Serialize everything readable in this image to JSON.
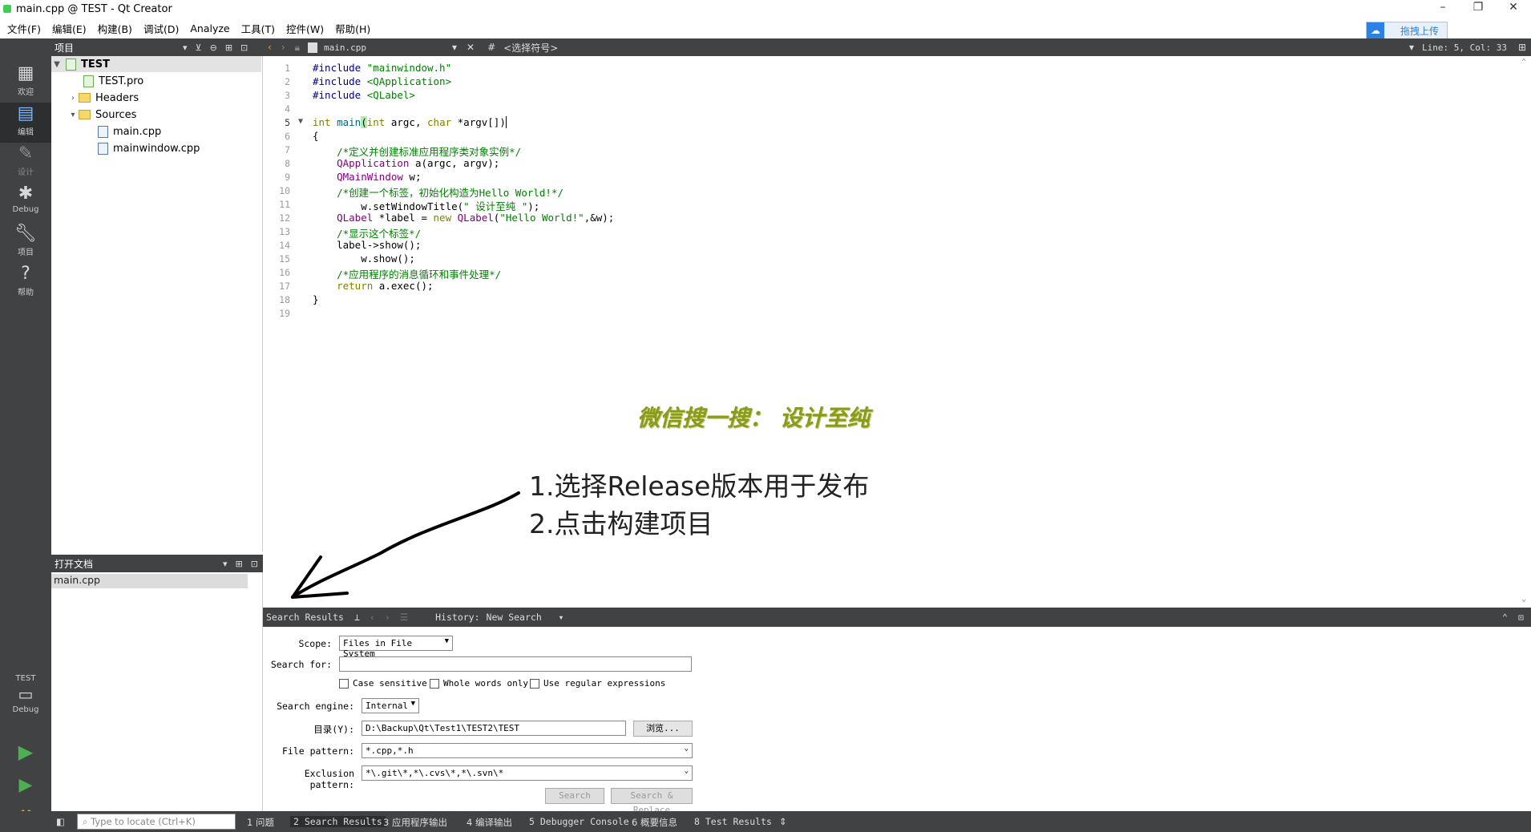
{
  "window": {
    "title": "main.cpp @ TEST - Qt Creator",
    "cloud_label": "拖拽上传"
  },
  "menu": [
    "文件(F)",
    "编辑(E)",
    "构建(B)",
    "调试(D)",
    "Analyze",
    "工具(T)",
    "控件(W)",
    "帮助(H)"
  ],
  "modes": [
    {
      "label": "欢迎",
      "icon": "grid-icon"
    },
    {
      "label": "编辑",
      "icon": "edit-doc-icon"
    },
    {
      "label": "设计",
      "icon": "pencil-icon"
    },
    {
      "label": "Debug",
      "icon": "bug-icon"
    },
    {
      "label": "项目",
      "icon": "wrench-icon"
    },
    {
      "label": "帮助",
      "icon": "help-icon"
    }
  ],
  "kit": {
    "project": "TEST",
    "config": "Debug"
  },
  "project_pane": {
    "title": "项目"
  },
  "tree": {
    "root": "TEST",
    "pro": "TEST.pro",
    "headers": "Headers",
    "sources": "Sources",
    "files": [
      "main.cpp",
      "mainwindow.cpp"
    ]
  },
  "open_docs": {
    "title": "打开文档",
    "items": [
      "main.cpp"
    ]
  },
  "editor": {
    "file": "main.cpp",
    "symbol": "<选择符号>",
    "position": "Line: 5, Col: 33",
    "line_numbers": [
      "1",
      "2",
      "3",
      "4",
      "5",
      "6",
      "7",
      "8",
      "9",
      "10",
      "11",
      "12",
      "13",
      "14",
      "15",
      "16",
      "17",
      "18",
      "19"
    ],
    "code": {
      "l1a": "#include ",
      "l1b": "\"mainwindow.h\"",
      "l2a": "#include ",
      "l2b": "<QApplication>",
      "l3a": "#include ",
      "l3b": "<QLabel>",
      "l5a": "int ",
      "l5b": "main",
      "l5c": "(",
      "l5d": "int",
      "l5e": " argc, ",
      "l5f": "char",
      "l5g": " *argv[])",
      "l6": "{",
      "l7": "    /*定义并创建标准应用程序类对象实例*/",
      "l8a": "    ",
      "l8b": "QApplication",
      "l8c": " a(argc, argv);",
      "l9a": "    ",
      "l9b": "QMainWindow",
      "l9c": " w;",
      "l10": "    /*创建一个标签，初始化构造为Hello World!*/",
      "l11a": "        w.setWindowTitle(",
      "l11b": "\" 设计至纯 \"",
      "l11c": ");",
      "l12a": "    ",
      "l12b": "QLabel",
      "l12c": " *label = ",
      "l12d": "new",
      "l12e": " ",
      "l12f": "QLabel",
      "l12g": "(",
      "l12h": "\"Hello World!\"",
      "l12i": ",&w);",
      "l13": "    /*显示这个标签*/",
      "l14": "    label->show();",
      "l15": "        w.show();",
      "l16": "    /*应用程序的消息循环和事件处理*/",
      "l17a": "    ",
      "l17b": "return",
      "l17c": " a.exec();",
      "l18": "}"
    }
  },
  "annotations": {
    "wechat": "微信搜一搜： 设计至纯",
    "step1": "1.选择Release版本用于发布",
    "step2": "2.点击构建项目"
  },
  "search_panel": {
    "title": "Search Results",
    "history_label": "History:",
    "history_value": "New Search",
    "scope_label": "Scope:",
    "scope_value": "Files in File System",
    "search_for_label": "Search for:",
    "search_for_value": "",
    "case_sensitive": "Case sensitive",
    "whole_words": "Whole words only",
    "regex": "Use regular expressions",
    "engine_label": "Search engine:",
    "engine_value": "Internal",
    "dir_label": "目录(Y):",
    "dir_value": "D:\\Backup\\Qt\\Test1\\TEST2\\TEST",
    "browse": "浏览...",
    "file_pattern_label": "File pattern:",
    "file_pattern_value": "*.cpp,*.h",
    "exclusion_label": "Exclusion pattern:",
    "exclusion_value": "*\\.git\\*,*\\.cvs\\*,*\\.svn\\*",
    "search_btn": "Search",
    "replace_btn": "Search & Replace"
  },
  "status": {
    "locate_placeholder": "Type to locate (Ctrl+K)",
    "tabs": [
      "1 问题",
      "2 Search Results",
      "3 应用程序输出",
      "4 编译输出",
      "5 Debugger Console",
      "6 概要信息",
      "8 Test Results"
    ]
  }
}
